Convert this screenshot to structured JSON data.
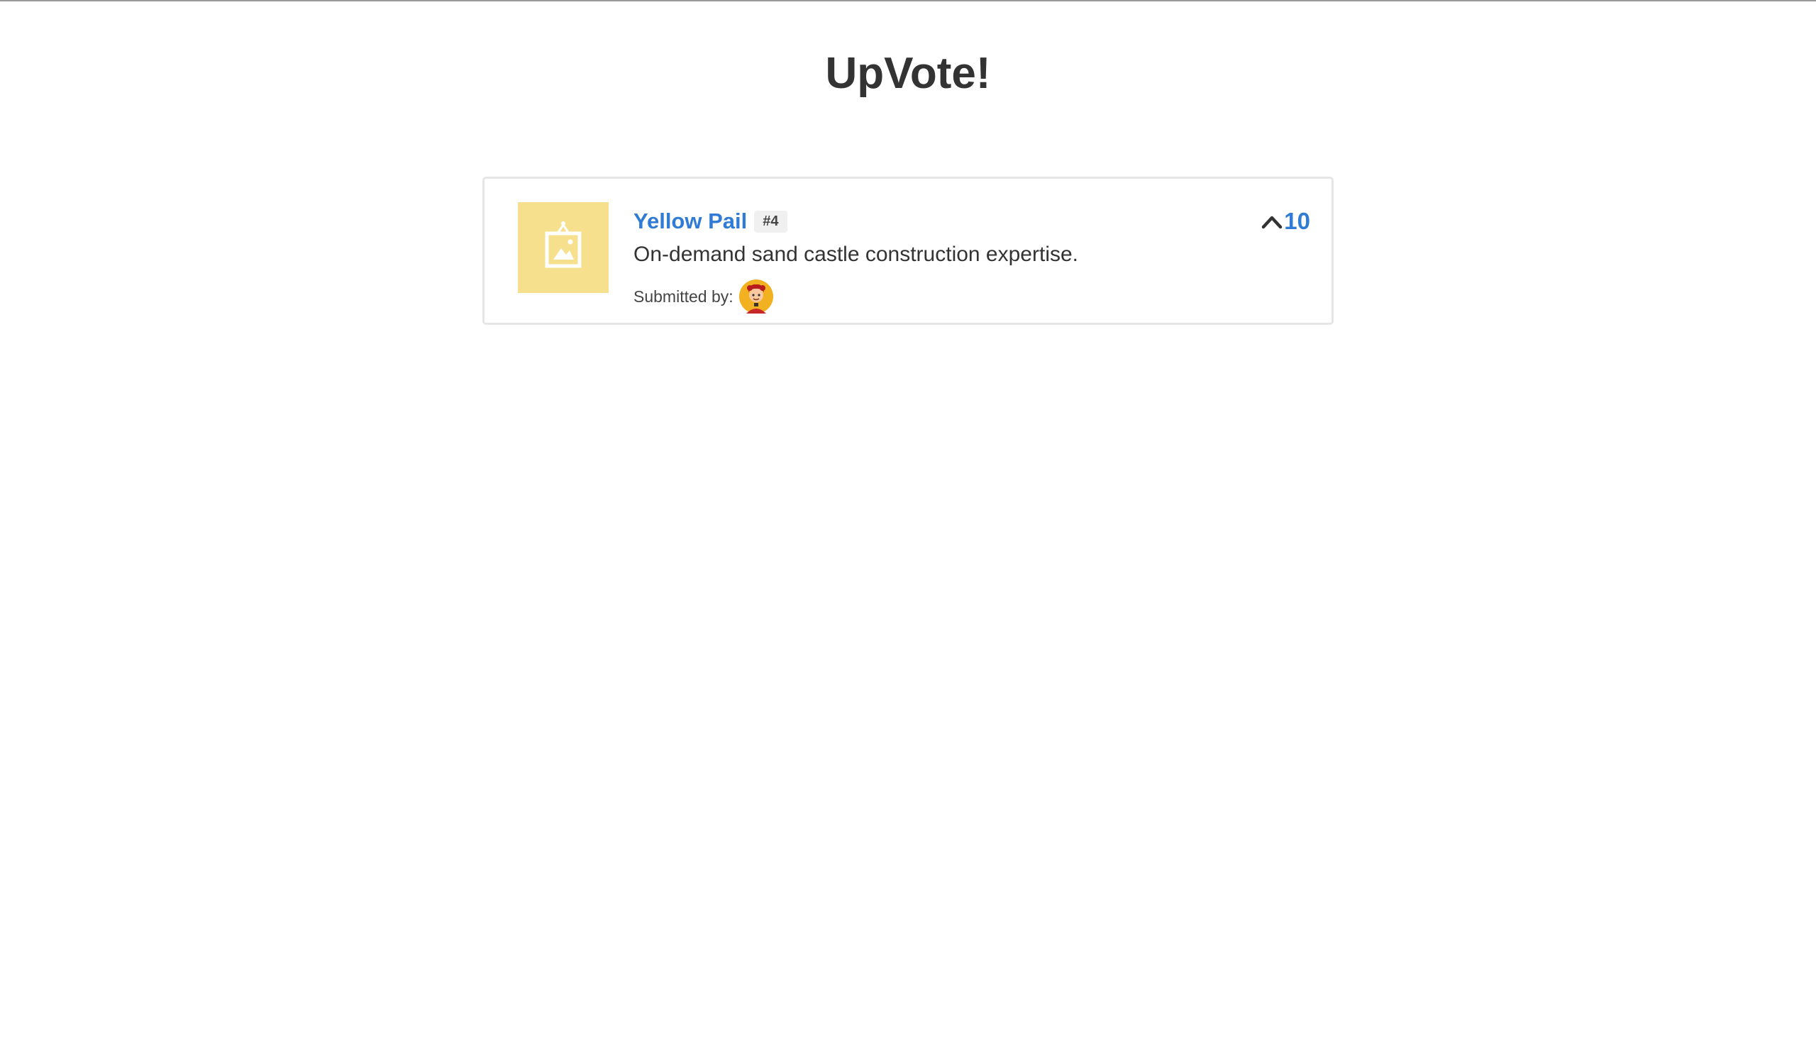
{
  "app": {
    "title": "UpVote!"
  },
  "products": [
    {
      "title": "Yellow Pail",
      "id_badge": "#4",
      "description": "On-demand sand castle construction expertise.",
      "submitted_label": "Submitted by:",
      "votes": "10",
      "image_icon": "image-placeholder-icon",
      "avatar_icon": "avatar-icon"
    }
  ],
  "colors": {
    "accent": "#2f7bd5",
    "thumbnail_bg": "#f6e08e",
    "text": "#333333",
    "card_border": "#e6e6e6"
  }
}
